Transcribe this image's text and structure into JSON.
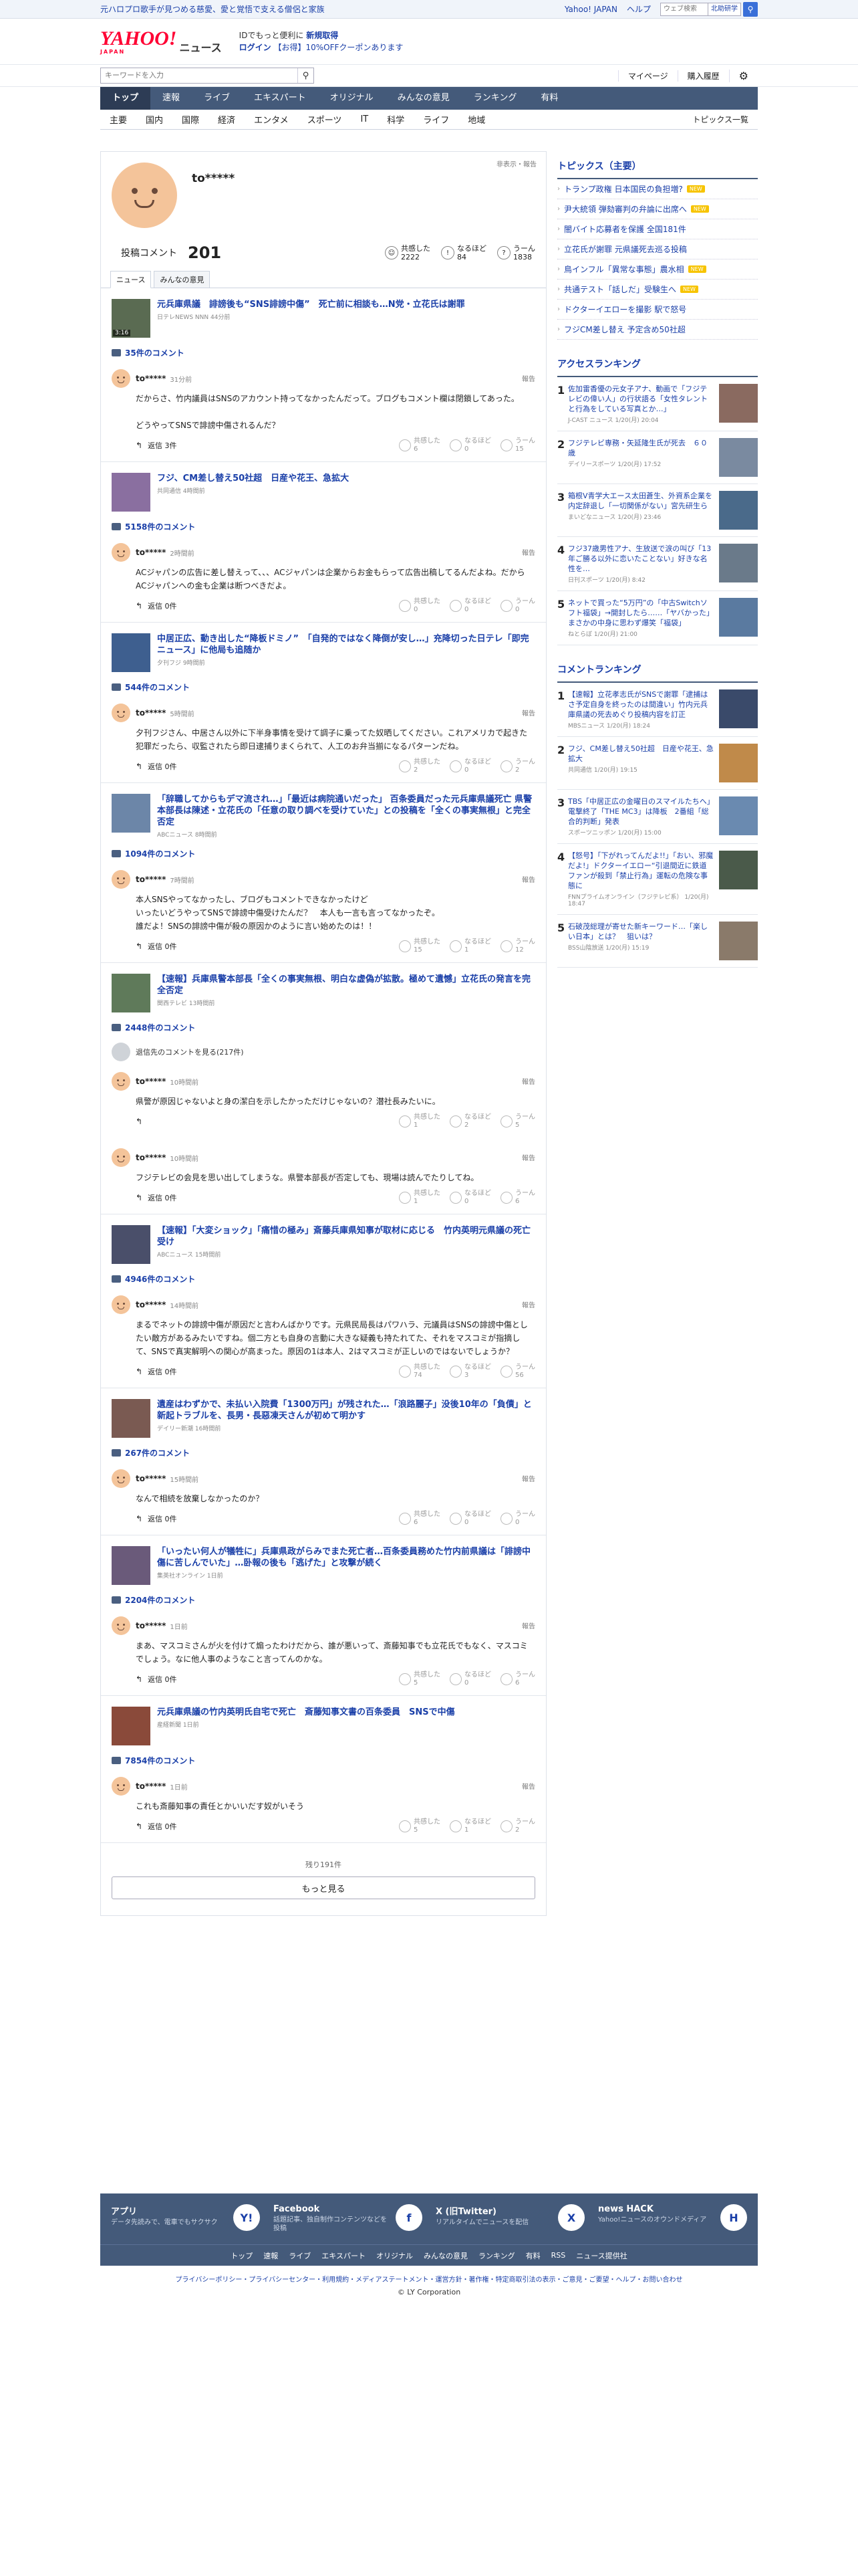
{
  "topbar": {
    "promo": "元ハロプロ歌手が見つめる慈愛、愛と覚悟で支える僧侶と家族",
    "links": [
      "Yahoo! JAPAN",
      "ヘルプ"
    ],
    "search_placeholder": "ウェブ検索",
    "search_scope": "北助研学"
  },
  "header": {
    "logo_main": "YAHOO!",
    "logo_sub": "JAPAN",
    "logo_news": "ニュース",
    "campaign_line1_prefix": "IDでもっと便利に",
    "campaign_line1_link": "新規取得",
    "campaign_line2_login": "ログイン",
    "campaign_line2_rest": "【お得】10%OFFクーポンあります"
  },
  "search": {
    "placeholder": "キーワードを入力",
    "right": [
      "マイページ",
      "購入履歴"
    ]
  },
  "nav": {
    "items": [
      "トップ",
      "速報",
      "ライブ",
      "エキスパート",
      "オリジナル",
      "みんなの意見",
      "ランキング",
      "有料"
    ]
  },
  "subnav": {
    "items": [
      "主要",
      "国内",
      "国際",
      "経済",
      "エンタメ",
      "スポーツ",
      "IT",
      "科学",
      "ライフ",
      "地域"
    ],
    "right": "トピックス一覧"
  },
  "profile": {
    "username": "to*****",
    "hide_label": "非表示・報告",
    "comments_label": "投稿コメント",
    "comments_count": "201",
    "reactions": [
      {
        "label": "共感した",
        "count": "2222"
      },
      {
        "label": "なるほど",
        "count": "84"
      },
      {
        "label": "うーん",
        "count": "1838"
      }
    ],
    "tabs": [
      "ニュース",
      "みんなの意見"
    ]
  },
  "entries": [
    {
      "title": "元兵庫県議　誹謗後も“SNS誹謗中傷”　死亡前に相談も…N党・立花氏は謝罪",
      "source": "日テレNEWS NNN 44分前",
      "video": "3:16",
      "comments": "35件のコメント",
      "user": "to*****",
      "time": "31分前",
      "body": "だからさ、竹内議員はSNSのアカウント持ってなかったんだって。ブログもコメント欄は閉鎖してあった。\n\nどうやってSNSで誹謗中傷されるんだ？",
      "replies": "返信 3件",
      "r": [
        "6",
        "0",
        "15"
      ]
    },
    {
      "title": "フジ、CM差し替え50社超　日産や花王、急拡大",
      "source": "共同通信 4時間前",
      "comments": "5158件のコメント",
      "user": "to*****",
      "time": "2時間前",
      "body": "ACジャパンの広告に差し替えって、、、ACジャパンは企業からお金もらって広告出稿してるんだよね。だからACジャパンへの金も企業は断つべきだよ。",
      "replies": "返信 0件",
      "r": [
        "0",
        "0",
        "0"
      ]
    },
    {
      "title": "中居正広、動き出した“降板ドミノ”　「自発的ではなく降倒が安し…」充降切った日テレ「即完ニュース」に他局も追随か",
      "source": "夕刊フジ 9時間前",
      "comments": "544件のコメント",
      "user": "to*****",
      "time": "5時間前",
      "body": "夕刊フジさん、中居さん以外に下半身事情を受けて調子に乗ってた奴晒してください。これアメリカで起きた犯罪だったら、収監されたら即日逮捕りまくられて、人工のお弁当揃になるパターンだね。",
      "replies": "返信 0件",
      "r": [
        "2",
        "0",
        "2"
      ]
    },
    {
      "title": "「辞職してからもデマ流され…」「最近は病院通いだった」 百条委員だった元兵庫県議死亡 県警本部長は陳述・立花氏の「任意の取り調べを受けていた」との投稿を「全くの事実無根」と完全否定",
      "source": "ABCニュース 8時間前",
      "comments": "1094件のコメント",
      "user": "to*****",
      "time": "7時間前",
      "body": "本人SNSやってなかったし、ブログもコメントできなかったけど\nいったいどうやってSNSで誹謗中傷受けたんだ？　本人も一言も言ってなかったぞ。\n誰だよ！SNSの誹謗中傷が殺の原因かのように言い始めたのは！！",
      "replies": "返信 0件",
      "r": [
        "15",
        "1",
        "12"
      ]
    },
    {
      "title": "【速報】兵庫県警本部長「全くの事実無根、明白な虚偽が拡散。極めて遺憾」立花氏の発言を完全否定",
      "source": "関西テレビ 13時間前",
      "comments": "2448件のコメント",
      "deleted": "退信先のコメントを見る(217件)",
      "user": "to*****",
      "time": "10時間前",
      "body": "県警が原因じゃないよと身の潔白を示したかっただけじゃないの？潜社長みたいに。",
      "replies": "",
      "r": [
        "1",
        "2",
        "5"
      ],
      "user2": "to*****",
      "time2": "10時間前",
      "body2": "フジテレビの会見を思い出してしまうな。県警本部長が否定しても、現場は読んでたりしてね。",
      "replies2": "返信 0件",
      "r2": [
        "1",
        "0",
        "6"
      ]
    },
    {
      "title": "【速報】「大変ショック」「痛惜の極み」斎藤兵庫県知事が取材に応じる　竹内英明元県議の死亡受け",
      "source": "ABCニュース 15時間前",
      "comments": "4946件のコメント",
      "user": "to*****",
      "time": "14時間前",
      "body": "まるでネットの誹謗中傷が原因だと言わんばかりです。元県民局長はパワハラ、元議員はSNSの誹謗中傷としたい敵方があるみたいですね。個二方とも自身の言動に大きな疑義も持たれてた、それをマスコミが指摘して、SNSで真実解明への関心が高まった。原因の1は本人、2はマスコミが正しいのではないでしょうか？",
      "replies": "返信 0件",
      "r": [
        "74",
        "3",
        "56"
      ]
    },
    {
      "title": "遺産はわずかで、未払い入院費「1300万円」が残された…「浪路麗子」没後10年の「負債」と新起トラブルを、長男・長惡凍天さんが初めて明かす",
      "source": "デイリー新潮 16時間前",
      "comments": "267件のコメント",
      "user": "to*****",
      "time": "15時間前",
      "body": "なんで相続を放棄しなかったのか？",
      "replies": "返信 0件",
      "r": [
        "6",
        "0",
        "0"
      ]
    },
    {
      "title": "「いったい何人が犠牲に」兵庫県政がらみでまた死亡者…百条委員務めた竹内前県議は「誹謗中傷に苦しんでいた」…卧報の後も「逃げた」と攻撃が続く",
      "source": "集英社オンライン 1日前",
      "comments": "2204件のコメント",
      "user": "to*****",
      "time": "1日前",
      "body": "まあ、マスコミさんが火を付けて煽ったわけだから、誰が悪いって、斎藤知事でも立花氏でもなく、マスコミでしょう。なに他人事のようなこと言ってんのかな。",
      "replies": "返信 0件",
      "r": [
        "5",
        "0",
        "6"
      ]
    },
    {
      "title": "元兵庫県議の竹内英明氏自宅で死亡　斎藤知事文書の百条委員　SNSで中傷",
      "source": "産経新聞 1日前",
      "comments": "7854件のコメント",
      "user": "to*****",
      "time": "1日前",
      "body": "これも斎藤知事の責任とかいいだす奴がいそう",
      "replies": "返信 0件",
      "r": [
        "5",
        "1",
        "2"
      ]
    }
  ],
  "reaction_labels": [
    "共感した",
    "なるほど",
    "うーん"
  ],
  "report_label": "報告",
  "more": {
    "remaining": "残り191件",
    "button": "もっと見る"
  },
  "sidebar": {
    "topics_title": "トピックス（主要）",
    "topics": [
      {
        "text": "トランプ政権 日本国民の負担増?",
        "new": true
      },
      {
        "text": "尹大統領 弾劾審判の弁論に出席へ",
        "new": true
      },
      {
        "text": "闇バイト応募者を保護 全国181件",
        "new": false
      },
      {
        "text": "立花氏が謝罪 元県議死去巡る投稿",
        "new": false
      },
      {
        "text": "鳥インフル「異常な事態」農水相",
        "new": true
      },
      {
        "text": "共通テスト「話しだ」受験生へ",
        "new": true
      },
      {
        "text": "ドクターイエローを撮影 駅で怒号",
        "new": false
      },
      {
        "text": "フジCM差し替え 予定含め50社超",
        "new": false
      }
    ],
    "new_label": "NEW",
    "access_title": "アクセスランキング",
    "access": [
      {
        "title": "佐加雷香優の元女子アナ、動画で「フジテレビの偉い人」の行状語る「女性タレントと行為をしている写真とか…」",
        "src": "J-CAST ニュース 1/20(月) 20:04"
      },
      {
        "title": "フジテレビ専務・矢延隆生氏が死去　６０歳",
        "src": "デイリースポーツ 1/20(月) 17:52"
      },
      {
        "title": "箱根V青学大エース太田蒼生、外資系企業を内定辞退し「一切関係がない」宮先研生ら",
        "src": "まいどなニュース 1/20(月) 23:46"
      },
      {
        "title": "フジ37歳男性アナ、生放送で涙の叫び「13年ご勝る以外に恋いたことない」好きな名性を…",
        "src": "日刊スポーツ 1/20(月) 8:42"
      },
      {
        "title": "ネットで買った“5万円”の「中古Switchソフト福袋」→開封したら……「ヤバかった」まさかの中身に思わず爆笑「福袋」",
        "src": "ねとらぼ 1/20(月) 21:00"
      }
    ],
    "comment_title": "コメントランキング",
    "commentrank": [
      {
        "title": "【速報】立花孝志氏がSNSで謝罪「逮捕はさ予定自身を終ったのは間違い」竹内元兵庫県議の死去めぐり投稿内容を訂正",
        "src": "MBSニュース 1/20(月) 18:24"
      },
      {
        "title": "フジ、CM差し替え50社超　日産や花王、急拡大",
        "src": "共同通信 1/20(月) 19:15"
      },
      {
        "title": "TBS「中居正広の金曜日のスマイルたちへ」電撃終了「THE MC3」は降板　2番組「総合的判断」発表",
        "src": "スポーツニッポン 1/20(月) 15:00"
      },
      {
        "title": "【怒号】「下がれってんだよ!!」「おい、邪魔だよ!」ドクターイエロー“引退間近に鉄道ファンが殺到「禁止行為」運転の危険な事態に",
        "src": "FNNプライムオンライン（フジテレビ系） 1/20(月) 18:47"
      },
      {
        "title": "石破茂総理が寄せた新キーワード…「楽しい日本」とは？　狙いは？",
        "src": "BSS山陰放送 1/20(月) 15:19"
      }
    ]
  },
  "footer": {
    "promos": [
      {
        "title": "アプリ",
        "desc": "データ先読みで、電車でもサクサク",
        "icon": "Y!"
      },
      {
        "title": "Facebook",
        "desc": "話題記事、独自制作コンテンツなどを投稿",
        "icon": "f"
      },
      {
        "title": "X (旧Twitter)",
        "desc": "リアルタイムでニュースを配信",
        "icon": "X"
      },
      {
        "title": "news HACK",
        "desc": "Yahoo!ニュースのオウンドメディア",
        "icon": "H"
      }
    ],
    "nav": [
      "トップ",
      "速報",
      "ライブ",
      "エキスパート",
      "オリジナル",
      "みんなの意見",
      "ランキング",
      "有料",
      "RSS",
      "ニュース提供社"
    ],
    "links": "プライバシーポリシー・プライバシーセンター・利用規約・メディアステートメント・運営方針・著作権・特定商取引法の表示・ご意見・ご要望・ヘルプ・お問い合わせ",
    "copyright": "© LY Corporation"
  }
}
